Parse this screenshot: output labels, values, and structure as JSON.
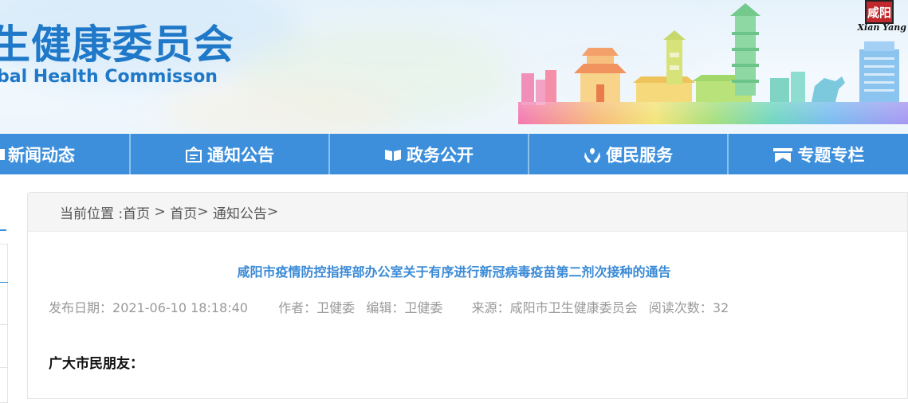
{
  "banner": {
    "title_cn": "生健康委员会",
    "title_en": "bal Health Commisson",
    "logo_text": "Xian Yang",
    "logo_seal": "咸阳"
  },
  "nav": [
    {
      "label": "新闻动态",
      "icon": "newspaper-icon"
    },
    {
      "label": "通知公告",
      "icon": "notice-board-icon"
    },
    {
      "label": "政务公开",
      "icon": "open-book-icon"
    },
    {
      "label": "便民服务",
      "icon": "hands-care-icon"
    },
    {
      "label": "专题专栏",
      "icon": "banner-flag-icon"
    }
  ],
  "breadcrumb": {
    "prefix": "当前位置 : ",
    "items": [
      "首页",
      "首页",
      "通知公告"
    ],
    "separators": [
      " > ",
      "> ",
      ">"
    ]
  },
  "article": {
    "title": "咸阳市疫情防控指挥部办公室关于有序进行新冠病毒疫苗第二剂次接种的通告",
    "meta": {
      "publish_label": "发布日期：",
      "publish_date": "2021-06-10 18:18:40",
      "author_label": "作者：",
      "author": "卫健委",
      "editor_label": "编辑：",
      "editor": "卫健委",
      "source_label": "来源：",
      "source": "咸阳市卫生健康委员会",
      "reads_label": "阅读次数：",
      "reads": "32"
    },
    "greeting": "广大市民朋友："
  },
  "colors": {
    "primary_blue": "#3d8fdb",
    "title_blue": "#1f78c8",
    "article_title_blue": "#3a8ad6",
    "meta_gray": "#999999"
  }
}
